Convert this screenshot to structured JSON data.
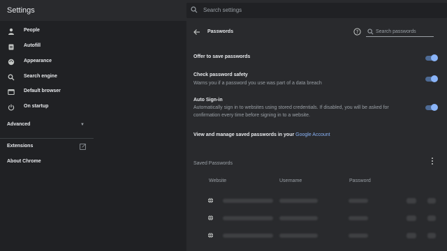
{
  "app": {
    "title": "Settings"
  },
  "search": {
    "placeholder": "Search settings"
  },
  "sidebar": {
    "items": [
      {
        "label": "People",
        "icon": "person-icon"
      },
      {
        "label": "Autofill",
        "icon": "clipboard-icon"
      },
      {
        "label": "Appearance",
        "icon": "palette-icon"
      },
      {
        "label": "Search engine",
        "icon": "search-icon"
      },
      {
        "label": "Default browser",
        "icon": "browser-icon"
      },
      {
        "label": "On startup",
        "icon": "power-icon"
      }
    ],
    "advanced": "Advanced",
    "extensions": "Extensions",
    "about": "About Chrome"
  },
  "passwords": {
    "title": "Passwords",
    "search_placeholder": "Search passwords",
    "offer": {
      "label": "Offer to save passwords",
      "enabled": true
    },
    "check": {
      "label": "Check password safety",
      "sublabel": "Warns you if a password you use was part of a data breach",
      "enabled": true
    },
    "auto_signin": {
      "label": "Auto Sign-in",
      "sublabel_line1": "Automatically sign in to websites using stored credentials. If disabled, you will be asked for",
      "sublabel_line2": "confirmation every time before signing in to a website.",
      "enabled": true
    },
    "manage_text": "View and manage saved passwords in your ",
    "manage_link": "Google Account",
    "saved_title": "Saved Passwords",
    "columns": [
      "Website",
      "Username",
      "Password"
    ]
  },
  "colors": {
    "accent": "#8ab4f8",
    "highlight": "#e8355b",
    "background": "#202124",
    "surface": "#292a2d"
  }
}
